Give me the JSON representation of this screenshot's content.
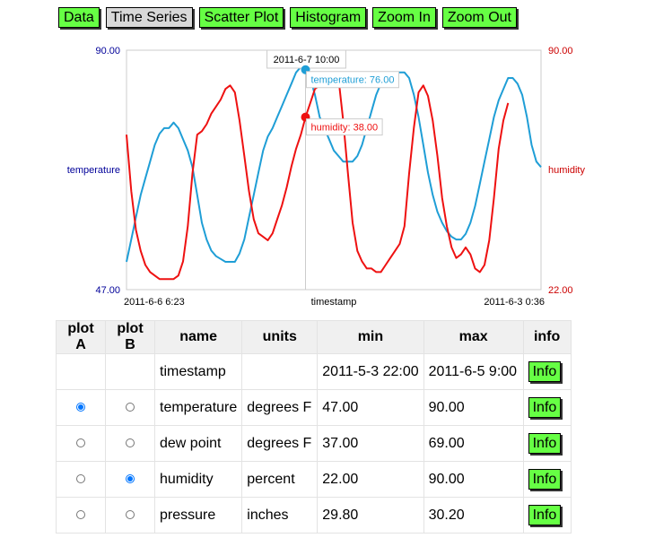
{
  "toolbar": {
    "buttons": [
      {
        "label": "Data",
        "active": false
      },
      {
        "label": "Time Series",
        "active": true
      },
      {
        "label": "Scatter Plot",
        "active": false
      },
      {
        "label": "Histogram",
        "active": false
      },
      {
        "label": "Zoom In",
        "active": false
      },
      {
        "label": "Zoom Out",
        "active": false
      }
    ]
  },
  "colors": {
    "temperature": "#1f9ed6",
    "humidity": "#ee1111",
    "left_axis": "#000099",
    "right_axis": "#cc0000",
    "button_green": "#66ff44"
  },
  "chart_data": {
    "type": "line",
    "x_label": "timestamp",
    "x_start_label": "2011-6-6 6:23",
    "x_end_label": "2011-6-3 0:36",
    "cursor_label": "2011-6-7 10:00",
    "left_axis": {
      "label": "temperature",
      "min": 47.0,
      "max": 90.0,
      "min_label": "47.00",
      "max_label": "90.00"
    },
    "right_axis": {
      "label": "humidity",
      "min": 22.0,
      "max": 90.0,
      "min_label": "22.00",
      "max_label": "90.00"
    },
    "cursor_index": 38,
    "series": [
      {
        "name": "temperature",
        "axis": "left",
        "tooltip": "temperature: 76.00",
        "values": [
          52.0,
          56.0,
          60.0,
          64.0,
          67.0,
          70.0,
          73.0,
          75.0,
          76.0,
          76.0,
          77.0,
          76.0,
          74.0,
          72.0,
          69.0,
          64.0,
          59.0,
          56.0,
          54.0,
          53.0,
          52.5,
          52.0,
          52.0,
          52.0,
          53.5,
          56.0,
          60.0,
          64.0,
          68.0,
          72.0,
          74.5,
          76.0,
          78.0,
          80.0,
          82.0,
          84.0,
          86.0,
          87.0,
          86.5,
          85.0,
          82.0,
          78.0,
          76.0,
          74.0,
          72.0,
          71.0,
          70.0,
          70.0,
          70.0,
          71.0,
          73.0,
          76.0,
          79.0,
          82.0,
          84.0,
          86.0,
          86.0,
          86.0,
          86.0,
          86.0,
          85.0,
          82.0,
          78.0,
          73.0,
          68.0,
          64.0,
          61.0,
          59.0,
          57.5,
          56.5,
          56.0,
          56.0,
          57.0,
          59.0,
          62.0,
          66.0,
          70.0,
          74.0,
          78.0,
          81.0,
          83.0,
          85.0,
          85.0,
          84.0,
          82.0,
          78.0,
          73.0,
          70.0,
          69.0
        ]
      },
      {
        "name": "humidity",
        "axis": "right",
        "tooltip": "humidity: 38.00",
        "values": [
          66.0,
          50.0,
          39.0,
          33.0,
          29.0,
          27.0,
          26.0,
          25.0,
          25.0,
          25.0,
          25.0,
          26.0,
          30.0,
          40.0,
          55.0,
          66.0,
          67.0,
          69.0,
          72.0,
          74.0,
          76.0,
          79.0,
          80.0,
          78.0,
          70.0,
          60.0,
          50.0,
          42.0,
          38.0,
          37.0,
          36.0,
          38.0,
          42.0,
          46.0,
          51.0,
          57.0,
          62.0,
          66.0,
          71.0,
          75.0,
          79.0,
          80.0,
          82.0,
          83.0,
          83.0,
          82.0,
          70.0,
          55.0,
          41.0,
          33.0,
          30.0,
          28.0,
          28.0,
          27.0,
          27.0,
          29.0,
          31.0,
          33.0,
          35.0,
          40.0,
          55.0,
          68.0,
          78.0,
          80.0,
          77.0,
          70.0,
          60.0,
          48.0,
          40.0,
          34.0,
          31.0,
          32.0,
          34.0,
          32.0,
          28.0,
          27.0,
          29.0,
          36.0,
          48.0,
          62.0,
          70.0,
          75.0
        ]
      }
    ]
  },
  "table": {
    "headers": [
      "plot A",
      "plot B",
      "name",
      "units",
      "min",
      "max",
      "info"
    ],
    "rows": [
      {
        "plot_a": null,
        "plot_b": null,
        "name": "timestamp",
        "units": "",
        "min": "2011-5-3 22:00",
        "max": "2011-6-5 9:00",
        "info": "Info"
      },
      {
        "plot_a": true,
        "plot_b": false,
        "name": "temperature",
        "units": "degrees F",
        "min": "47.00",
        "max": "90.00",
        "info": "Info"
      },
      {
        "plot_a": false,
        "plot_b": false,
        "name": "dew point",
        "units": "degrees F",
        "min": "37.00",
        "max": "69.00",
        "info": "Info"
      },
      {
        "plot_a": false,
        "plot_b": true,
        "name": "humidity",
        "units": "percent",
        "min": "22.00",
        "max": "90.00",
        "info": "Info"
      },
      {
        "plot_a": false,
        "plot_b": false,
        "name": "pressure",
        "units": "inches",
        "min": "29.80",
        "max": "30.20",
        "info": "Info"
      }
    ]
  }
}
